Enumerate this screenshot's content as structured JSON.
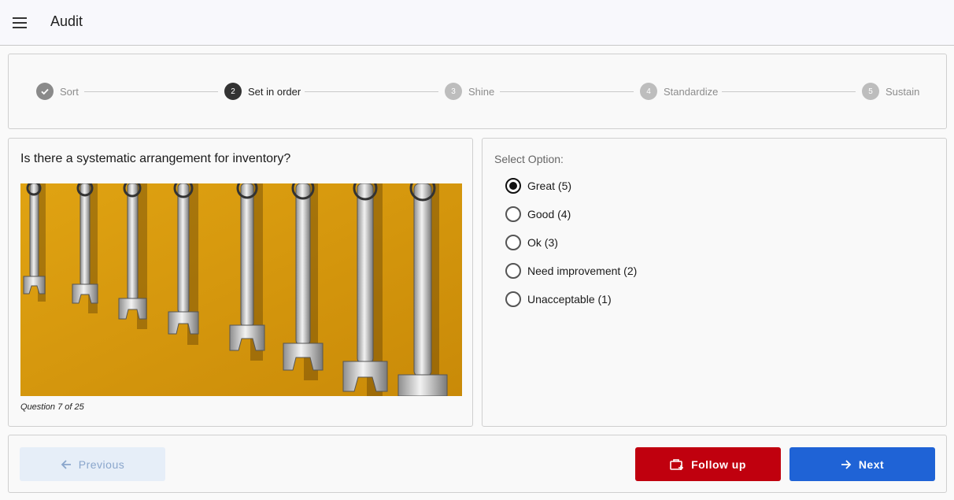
{
  "app": {
    "title": "Audit"
  },
  "stepper": {
    "steps": [
      {
        "number": "1",
        "label": "Sort",
        "state": "done"
      },
      {
        "number": "2",
        "label": "Set in order",
        "state": "active"
      },
      {
        "number": "3",
        "label": "Shine",
        "state": "pending"
      },
      {
        "number": "4",
        "label": "Standardize",
        "state": "pending"
      },
      {
        "number": "5",
        "label": "Sustain",
        "state": "pending"
      }
    ]
  },
  "question": {
    "text": "Is there a systematic arrangement for inventory?",
    "counter": "Question 7 of 25",
    "image_icon": "wrenches-photo"
  },
  "options": {
    "label": "Select Option:",
    "selected_index": 0,
    "items": [
      {
        "label": "Great (5)"
      },
      {
        "label": "Good (4)"
      },
      {
        "label": "Ok (3)"
      },
      {
        "label": "Need improvement (2)"
      },
      {
        "label": "Unacceptable (1)"
      }
    ]
  },
  "footer": {
    "previous_label": "Previous",
    "follow_up_label": "Follow up",
    "next_label": "Next"
  },
  "colors": {
    "follow_up": "#c0000e",
    "next": "#1f63d6",
    "previous_disabled": "#e6eef8",
    "image_background": "#d99a0e"
  }
}
